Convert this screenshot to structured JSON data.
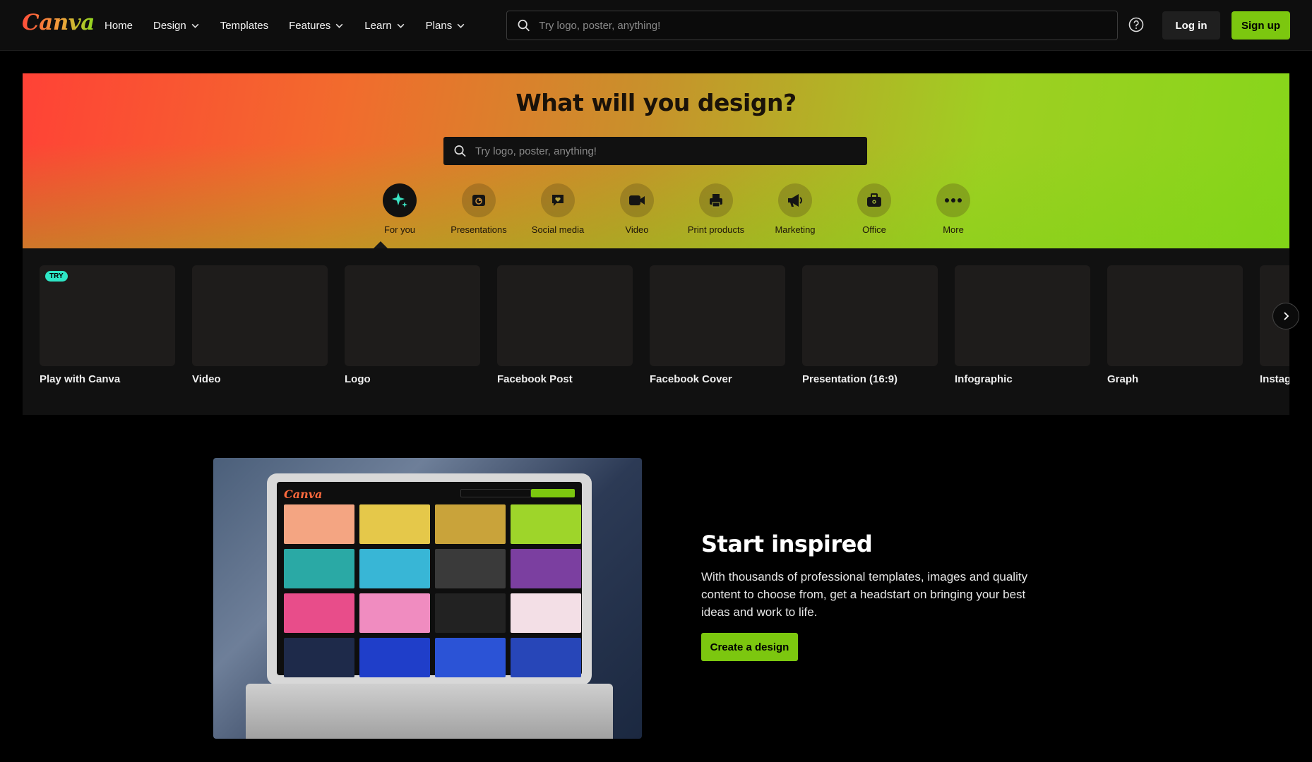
{
  "header": {
    "logo_text": "Canva",
    "nav": [
      {
        "label": "Home",
        "has_menu": false
      },
      {
        "label": "Design",
        "has_menu": true
      },
      {
        "label": "Templates",
        "has_menu": false
      },
      {
        "label": "Features",
        "has_menu": true
      },
      {
        "label": "Learn",
        "has_menu": true
      },
      {
        "label": "Plans",
        "has_menu": true
      }
    ],
    "search_placeholder": "Try logo, poster, anything!",
    "help_icon": "question-circle-icon",
    "login_label": "Log in",
    "signup_label": "Sign up"
  },
  "hero": {
    "title": "What will you design?",
    "search_placeholder": "Try logo, poster, anything!",
    "categories": [
      {
        "label": "For you",
        "icon": "sparkle-icon",
        "active": true
      },
      {
        "label": "Presentations",
        "icon": "presentation-icon",
        "active": false
      },
      {
        "label": "Social media",
        "icon": "heart-chat-icon",
        "active": false
      },
      {
        "label": "Video",
        "icon": "video-camera-icon",
        "active": false
      },
      {
        "label": "Print products",
        "icon": "printer-icon",
        "active": false
      },
      {
        "label": "Marketing",
        "icon": "megaphone-icon",
        "active": false
      },
      {
        "label": "Office",
        "icon": "briefcase-icon",
        "active": false
      },
      {
        "label": "More",
        "icon": "more-dots-icon",
        "active": false
      }
    ]
  },
  "templates": {
    "items": [
      {
        "label": "Play with Canva",
        "badge": "TRY"
      },
      {
        "label": "Video"
      },
      {
        "label": "Logo"
      },
      {
        "label": "Facebook Post"
      },
      {
        "label": "Facebook Cover"
      },
      {
        "label": "Presentation (16:9)"
      },
      {
        "label": "Infographic"
      },
      {
        "label": "Graph"
      },
      {
        "label": "Instag"
      }
    ],
    "next_icon": "chevron-right-icon"
  },
  "feature": {
    "title": "Start inspired",
    "body": "With thousands of professional templates, images and quality content to choose from, get a headstart on bringing your best ideas and work to life.",
    "button_label": "Create a design",
    "screen_logo": "Canva"
  },
  "colors": {
    "accent_green": "#7cc70f",
    "try_badge": "#2ee6c6"
  }
}
